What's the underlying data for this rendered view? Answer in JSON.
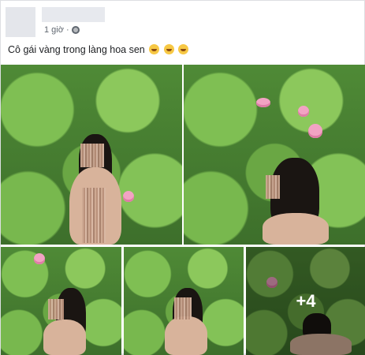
{
  "post": {
    "time": "1 giờ",
    "audience_icon": "globe-icon",
    "caption": "Cô gái vàng trong làng hoa sen",
    "emojis": [
      "grinning-squinting-face",
      "grinning-squinting-face",
      "grinning-squinting-face"
    ],
    "more_photos": "+4"
  }
}
